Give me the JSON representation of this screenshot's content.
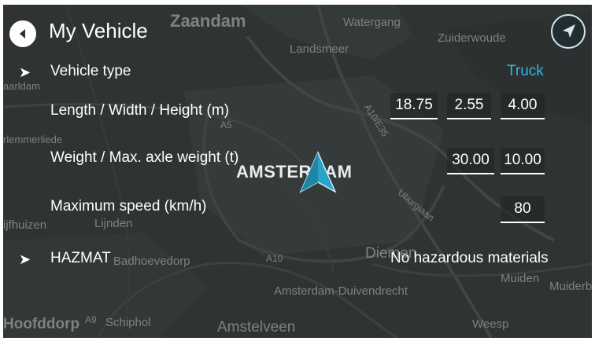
{
  "header": {
    "title": "My Vehicle"
  },
  "rows": {
    "vehicle_type": {
      "label": "Vehicle type",
      "value": "Truck"
    },
    "dimensions": {
      "label": "Length / Width / Height (m)",
      "length": "18.75",
      "width": "2.55",
      "height": "4.00"
    },
    "weight": {
      "label": "Weight / Max. axle weight (t)",
      "weight": "30.00",
      "axle": "10.00"
    },
    "speed": {
      "label": "Maximum speed (km/h)",
      "value": "80"
    },
    "hazmat": {
      "label": "HAZMAT",
      "value": "No hazardous materials"
    }
  },
  "map": {
    "places": {
      "zaandam": "Zaandam",
      "watergang": "Watergang",
      "landsmeer": "Landsmeer",
      "zuiderwoude": "Zuiderwoude",
      "amsterdam": "AMSTERDAM",
      "lijnden": "Lijnden",
      "badhoevedorp": "Badhoevedorp",
      "diemen": "Diemen",
      "muiden": "Muiden",
      "muiderberg": "Muiderb",
      "duivendrecht": "Amsterdam-Duivendrecht",
      "schiphol": "Schiphol",
      "amstelveen": "Amstelveen",
      "weesp": "Weesp",
      "hoofddorp": "Hoofddorp",
      "nieuwmeer": "rlemmerliede",
      "zwanenburg": "ijfhuizen",
      "zaandijk": "aarldam",
      "uburgiaan": "Uburgiaan"
    },
    "roads": {
      "a5": "A5",
      "a10e35": "A10/E35",
      "a10": "A10",
      "a9": "A9"
    }
  },
  "icons": {
    "back": "back-arrow-icon",
    "navigate": "navigation-arrow-icon",
    "chevron": "chevron-right-icon"
  },
  "colors": {
    "accent": "#34b6e4",
    "text": "#ffffff",
    "map_bg": "#3a3f3f"
  }
}
